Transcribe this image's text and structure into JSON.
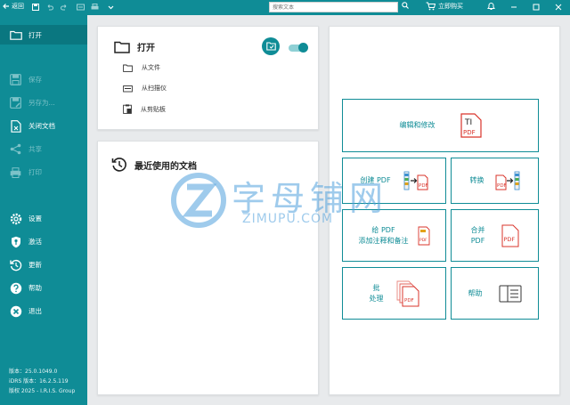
{
  "topbar": {
    "back_label": "返回",
    "search_placeholder": "搜索文本",
    "buy_label": "立即购买"
  },
  "sidebar": {
    "items": [
      {
        "label": "打开",
        "icon": "folder-icon",
        "state": "active"
      },
      {
        "label": "保存",
        "icon": "save-icon",
        "state": "disabled"
      },
      {
        "label": "另存为...",
        "icon": "save-as-icon",
        "state": "disabled"
      },
      {
        "label": "关闭文档",
        "icon": "close-document-icon",
        "state": "enabled"
      },
      {
        "label": "共享",
        "icon": "share-icon",
        "state": "disabled"
      },
      {
        "label": "打印",
        "icon": "print-icon",
        "state": "disabled"
      },
      {
        "label": "设置",
        "icon": "gear-icon",
        "state": "enabled"
      },
      {
        "label": "激活",
        "icon": "key-shield-icon",
        "state": "enabled"
      },
      {
        "label": "更新",
        "icon": "update-icon",
        "state": "enabled"
      },
      {
        "label": "帮助",
        "icon": "help-icon",
        "state": "enabled"
      },
      {
        "label": "退出",
        "icon": "exit-icon",
        "state": "enabled"
      }
    ],
    "version": "版本：25.0.1049.0",
    "idrs_version": "iDRS 版本：16.2.5.119",
    "copyright": "版权 2025 - I.R.I.S. Group"
  },
  "open_panel": {
    "title": "打开",
    "from_file": "从文件",
    "from_scanner": "从扫描仪",
    "from_clipboard": "从剪贴板"
  },
  "recent_panel": {
    "title": "最近使用的文档"
  },
  "actions": {
    "edit": "编辑和修改",
    "create_pdf": "创建 PDF",
    "convert": "转换",
    "annotate_line1": "给 PDF",
    "annotate_line2": "添加注释和备注",
    "merge_line1": "合并",
    "merge_line2": "PDF",
    "batch_line1": "批",
    "batch_line2": "处理",
    "help": "帮助"
  },
  "watermark": {
    "main": "字母铺网",
    "sub": "ZIMUPU.COM"
  },
  "colors": {
    "accent": "#0f8c96",
    "accent_dark": "#0a7780",
    "pdf_red": "#d9342b"
  }
}
